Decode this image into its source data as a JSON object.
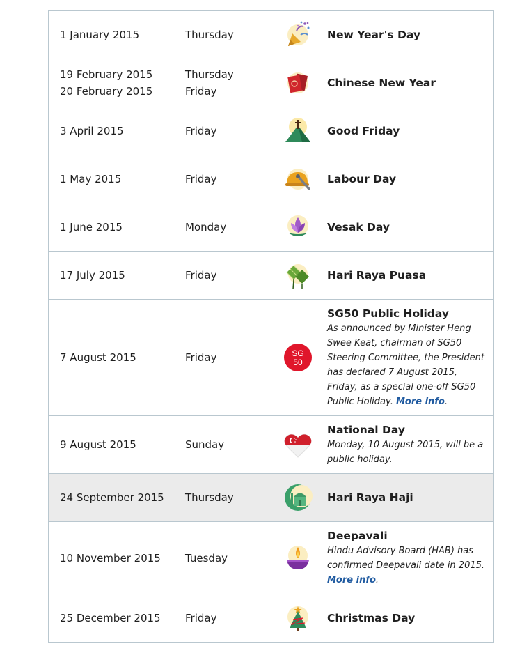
{
  "holidays": [
    {
      "dates": [
        "1 January 2015"
      ],
      "days": [
        "Thursday"
      ],
      "icon": "party-popper-icon",
      "name": "New Year's Day"
    },
    {
      "dates": [
        "19 February 2015",
        "20 February 2015"
      ],
      "days": [
        "Thursday",
        "Friday"
      ],
      "icon": "red-packet-icon",
      "name": "Chinese New Year"
    },
    {
      "dates": [
        "3 April 2015"
      ],
      "days": [
        "Friday"
      ],
      "icon": "cross-mountain-icon",
      "name": "Good Friday"
    },
    {
      "dates": [
        "1 May 2015"
      ],
      "days": [
        "Friday"
      ],
      "icon": "hard-hat-icon",
      "name": "Labour Day"
    },
    {
      "dates": [
        "1 June 2015"
      ],
      "days": [
        "Monday"
      ],
      "icon": "lotus-icon",
      "name": "Vesak Day"
    },
    {
      "dates": [
        "17 July 2015"
      ],
      "days": [
        "Friday"
      ],
      "icon": "ketupat-icon",
      "name": "Hari Raya Puasa"
    },
    {
      "dates": [
        "7 August 2015"
      ],
      "days": [
        "Friday"
      ],
      "icon": "sg50-logo-icon",
      "name": "SG50 Public Holiday",
      "note": "As announced by Minister Heng Swee Keat, chairman of SG50 Steering Committee, the President has declared 7 August 2015, Friday, as a special one-off SG50 Public Holiday.",
      "link": "More info",
      "link_suffix": "."
    },
    {
      "dates": [
        "9 August 2015"
      ],
      "days": [
        "Sunday"
      ],
      "icon": "singapore-heart-icon",
      "name": "National Day",
      "note": "Monday, 10 August 2015, will be a public holiday."
    },
    {
      "dates": [
        "24 September 2015"
      ],
      "days": [
        "Thursday"
      ],
      "icon": "crescent-mosque-icon",
      "name": "Hari Raya Haji",
      "highlighted": true
    },
    {
      "dates": [
        "10 November 2015"
      ],
      "days": [
        "Tuesday"
      ],
      "icon": "diya-lamp-icon",
      "name": "Deepavali",
      "note": "Hindu Advisory Board (HAB) has confirmed Deepavali date in 2015.",
      "link": "More info",
      "link_suffix": "."
    },
    {
      "dates": [
        "25 December 2015"
      ],
      "days": [
        "Friday"
      ],
      "icon": "christmas-tree-icon",
      "name": "Christmas Day"
    }
  ],
  "icon_texts": {
    "sg50_top": "SG",
    "sg50_bottom": "50"
  },
  "colors": {
    "border": "#b9c7cf",
    "link": "#1f5aa0",
    "highlight_row": "#ebebeb",
    "sg50_red": "#e0162b"
  }
}
